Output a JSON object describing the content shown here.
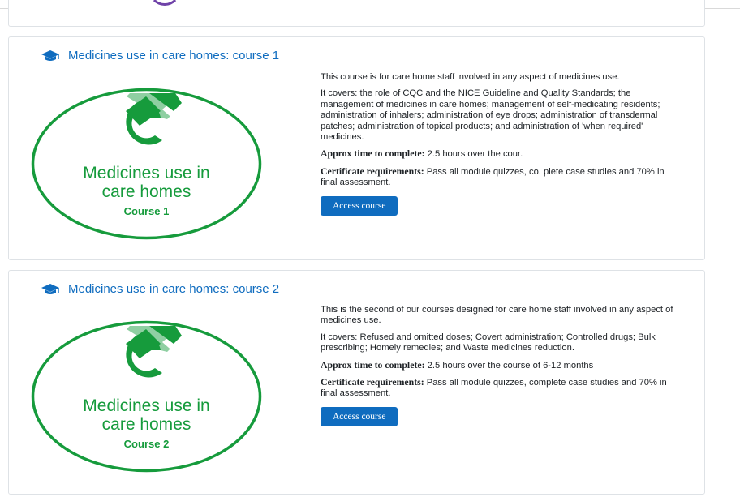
{
  "colors": {
    "link": "#0f6cbf",
    "badge_green": "#169b3c",
    "badge_light_green": "#8fcfa2",
    "button_bg": "#0f6cbf"
  },
  "courses": [
    {
      "title": "Medicines use in care homes: course 1",
      "icon": "graduation-cap-icon",
      "image": {
        "line1": "Medicines use in",
        "line2": "care homes",
        "line3": "Course 1"
      },
      "description": "This course is for care home staff involved in any aspect of medicines use.",
      "covers": "It covers: the role of CQC and the NICE Guideline and Quality Standards; the management of medicines in care homes; management of self-medicating residents; administration of inhalers; administration of eye drops; administration of transdermal patches; administration of topical products; and administration of 'when required' medicines.",
      "time_label": "Approx time to complete:",
      "time_value": " 2.5 hours over the cour.",
      "cert_label": "Certificate requirements:",
      "cert_value": " Pass all module quizzes, co.  plete case studies and 70% in final assessment.",
      "button": "Access course"
    },
    {
      "title": "Medicines use in care homes: course 2",
      "icon": "graduation-cap-icon",
      "image": {
        "line1": "Medicines use in",
        "line2": "care homes",
        "line3": "Course 2"
      },
      "description": "This is the second of our courses designed for care home staff involved in any aspect of medicines use.",
      "covers": "It covers: Refused and omitted doses; Covert administration; Controlled drugs; Bulk prescribing; Homely remedies; and Waste medicines reduction.",
      "time_label": "Approx time to complete:",
      "time_value": " 2.5 hours over the course of 6-12 months",
      "cert_label": "Certificate requirements:",
      "cert_value": " Pass all module quizzes, complete case studies and 70% in final assessment.",
      "button": "Access course"
    }
  ]
}
